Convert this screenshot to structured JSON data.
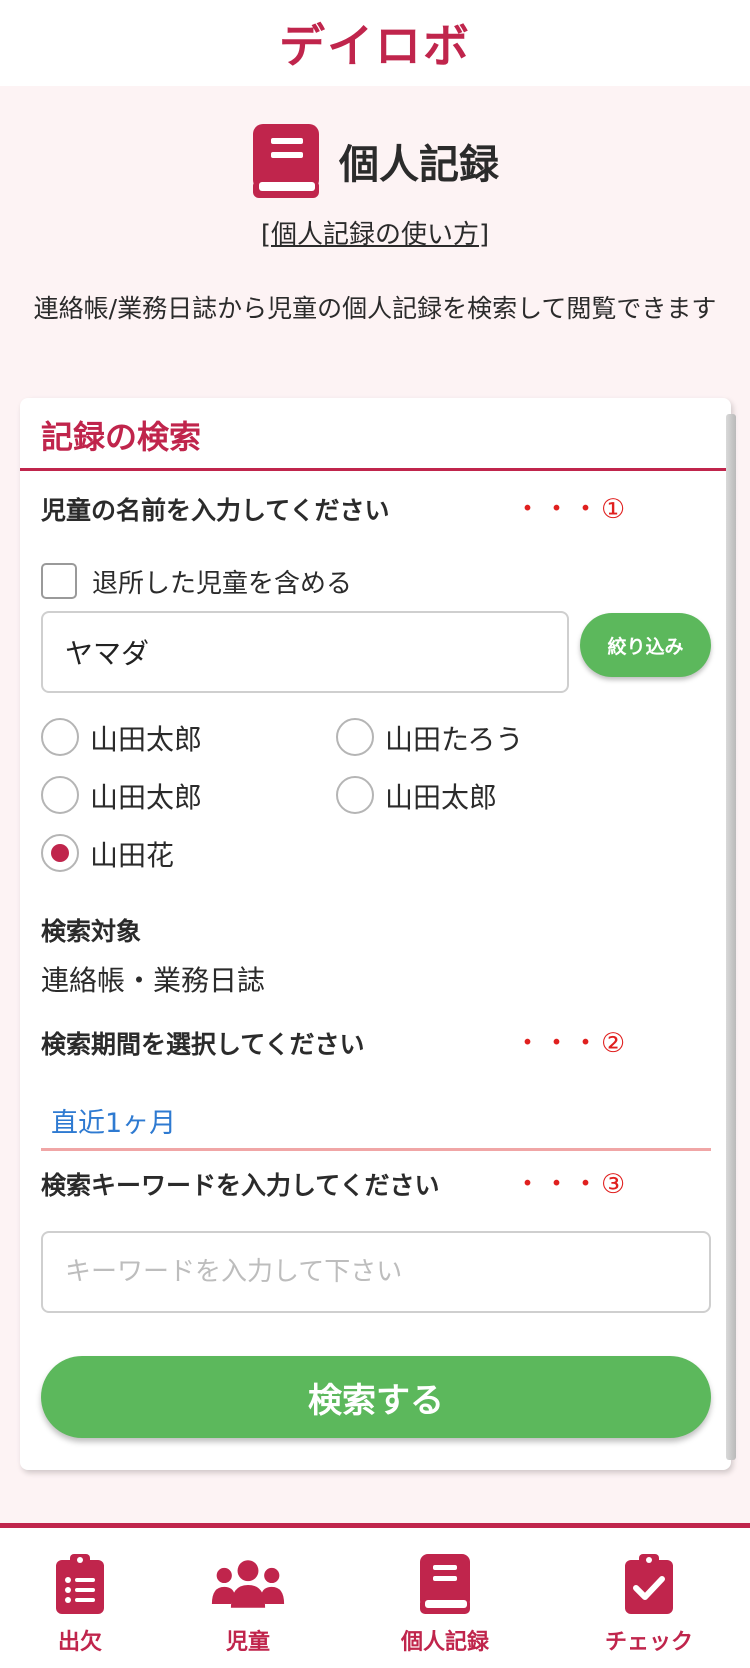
{
  "header": {
    "app_title": "デイロボ"
  },
  "page": {
    "title": "個人記録",
    "howto_link": "[個人記録の使い方]",
    "description": "連絡帳/業務日誌から児童の個人記録を検索して閲覧できます"
  },
  "search_card": {
    "title": "記録の検索",
    "name_section": {
      "label": "児童の名前を入力してください",
      "note": "・・・①",
      "include_retired_label": "退所した児童を含める",
      "include_retired_checked": false,
      "name_value": "ヤマダ",
      "filter_button": "絞り込み"
    },
    "children": [
      {
        "name": "山田太郎",
        "selected": false
      },
      {
        "name": "山田たろう",
        "selected": false
      },
      {
        "name": "山田太郎",
        "selected": false
      },
      {
        "name": "山田太郎",
        "selected": false
      },
      {
        "name": "山田花",
        "selected": true
      }
    ],
    "target": {
      "label": "検索対象",
      "value": "連絡帳・業務日誌"
    },
    "period": {
      "label": "検索期間を選択してください",
      "note": "・・・②",
      "value": "直近1ヶ月"
    },
    "keyword": {
      "label": "検索キーワードを入力してください",
      "note": "・・・③",
      "placeholder": "キーワードを入力して下さい"
    },
    "search_button": "検索する"
  },
  "bottom_nav": {
    "items": [
      {
        "label": "出欠",
        "icon": "clipboard-list-icon"
      },
      {
        "label": "児童",
        "icon": "users-icon"
      },
      {
        "label": "個人記録",
        "icon": "book-icon"
      },
      {
        "label": "チェック",
        "icon": "clipboard-check-icon"
      }
    ]
  },
  "colors": {
    "brand": "#c0254c",
    "button_green": "#5cb85c",
    "link_blue": "#2e7ad1",
    "note_red": "#e0201f"
  }
}
